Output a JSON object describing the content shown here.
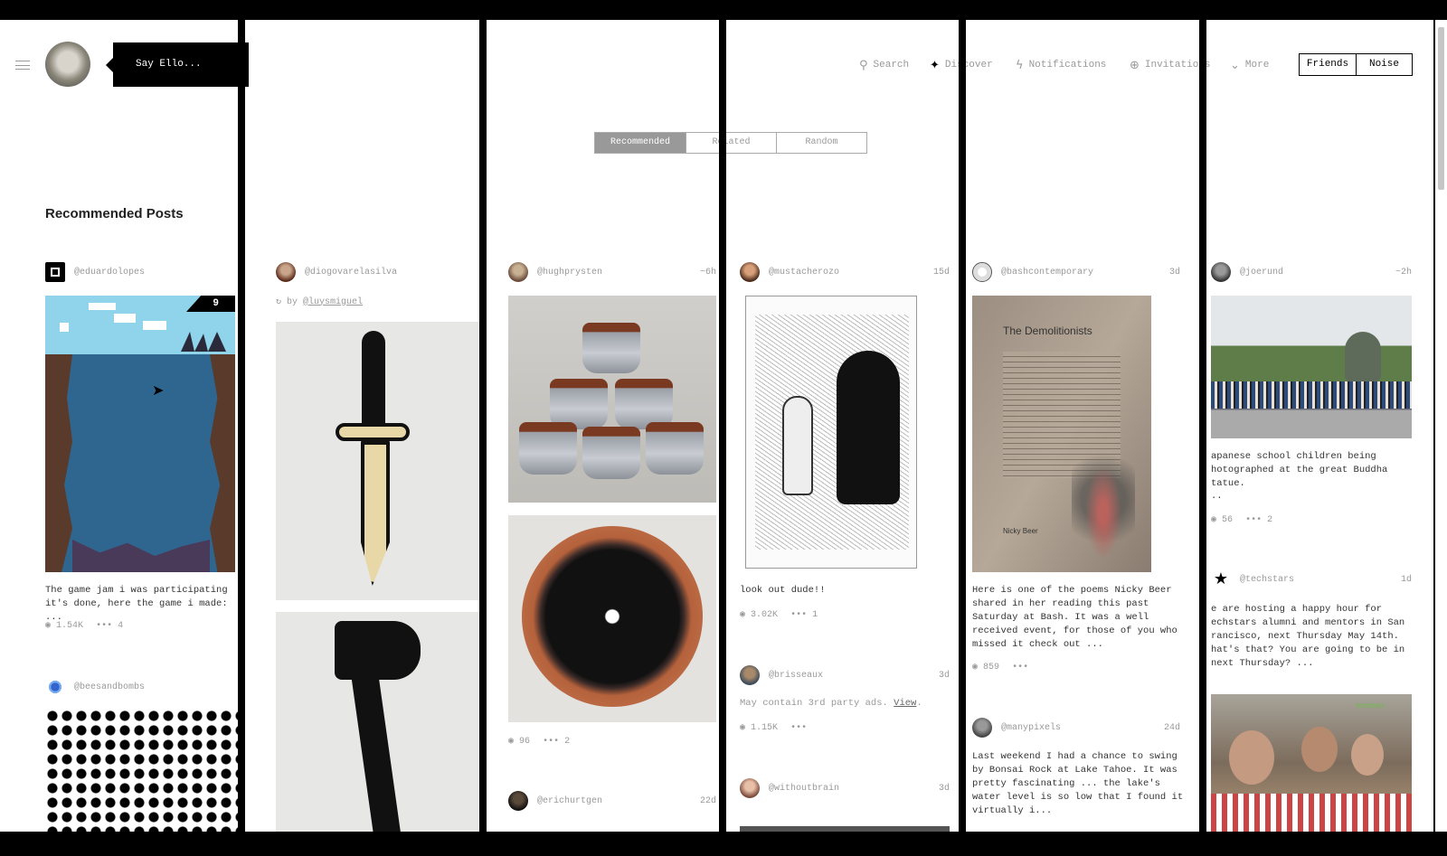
{
  "header": {
    "composer_placeholder": "Say Ello...",
    "nav": [
      {
        "icon": "search-icon",
        "label": "Search"
      },
      {
        "icon": "sparkle-icon",
        "label": "Discover"
      },
      {
        "icon": "bolt-icon",
        "label": "Notifications"
      },
      {
        "icon": "invite-icon",
        "label": "Invitations"
      },
      {
        "icon": "chevron-down-icon",
        "label": "More"
      }
    ],
    "toggle": [
      "Friends",
      "Noise"
    ]
  },
  "tabs": [
    "Recommended",
    "Related",
    "Random"
  ],
  "section_title": "Recommended Posts",
  "columns": [
    {
      "posts": [
        {
          "user": "@eduardolopes",
          "time": "",
          "badge": "9",
          "text": "The game jam i was participating it's done, here the game i made: ...",
          "views": "1.54K",
          "comments": "4"
        },
        {
          "user": "@beesandbombs",
          "time": ""
        }
      ]
    },
    {
      "posts": [
        {
          "user": "@diogovarelasilva",
          "time": "",
          "repost_by": "by",
          "repost_user": "@luysmiguel"
        }
      ]
    },
    {
      "posts": [
        {
          "user": "@hughprysten",
          "time": "~6h",
          "views": "96",
          "comments": "2"
        },
        {
          "user": "@erichurtgen",
          "time": "22d"
        }
      ]
    },
    {
      "posts": [
        {
          "user": "@mustacherozo",
          "time": "15d",
          "text": "look out dude!!",
          "views": "3.02K",
          "comments": "1"
        },
        {
          "user": "@brisseaux",
          "time": "3d",
          "text": "May contain 3rd party ads.",
          "link": "View",
          "views": "1.15K",
          "comments": ""
        },
        {
          "user": "@withoutbrain",
          "time": "3d"
        }
      ]
    },
    {
      "posts": [
        {
          "user": "@bashcontemporary",
          "time": "3d",
          "poem_title": "The Demolitionists",
          "poem_author": "Nicky Beer",
          "text": "Here is one of the poems Nicky Beer shared in her reading this past Saturday at Bash. It was a well received event, for those of you who missed it check out ...",
          "views": "859",
          "comments": ""
        },
        {
          "user": "@manypixels",
          "time": "24d",
          "text": "Last weekend I had a chance to swing by Bonsai Rock at Lake Tahoe. It was pretty fascinating ... the lake's water level is so low that I found it virtually i..."
        }
      ]
    },
    {
      "posts": [
        {
          "user": "@joerund",
          "time": "~2h",
          "text": "apanese school children being hotographed at the great Buddha tatue.",
          "more": "..",
          "views": "56",
          "comments": "2"
        },
        {
          "user": "@techstars",
          "time": "1d",
          "text": "e are hosting a happy hour for echstars alumni and mentors in San rancisco, next Thursday May 14th. hat's that? You are going to be in  next Thursday? ...",
          "photo_label": "techstars"
        }
      ]
    }
  ]
}
